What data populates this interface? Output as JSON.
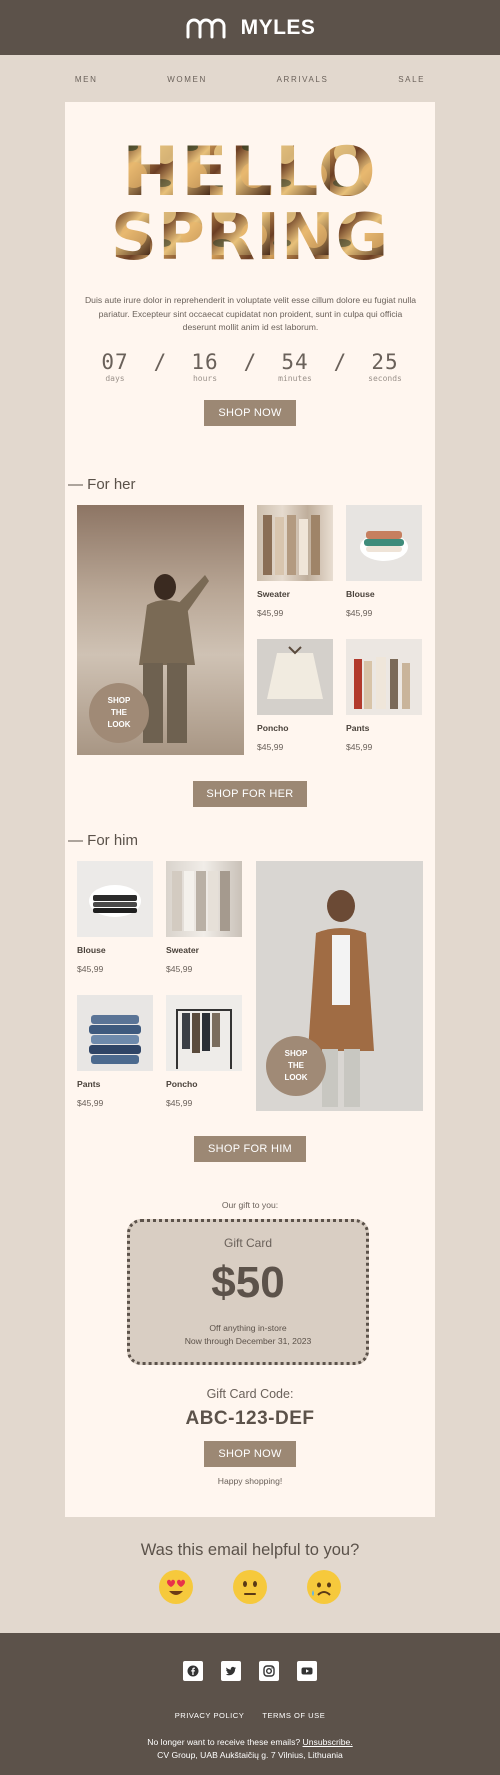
{
  "brand": {
    "name": "MYLES"
  },
  "nav": {
    "items": [
      "MEN",
      "WOMEN",
      "ARRIVALS",
      "SALE"
    ]
  },
  "hero": {
    "headline_line1": "HELLO",
    "headline_line2": "SPRING",
    "body": "Duis aute irure dolor in reprehenderit in voluptate velit esse cillum dolore eu fugiat nulla pariatur. Excepteur sint occaecat cupidatat non proident, sunt in culpa qui officia deserunt mollit anim id est laborum.",
    "countdown": [
      {
        "value": "07",
        "label": "days"
      },
      {
        "value": "16",
        "label": "hours"
      },
      {
        "value": "54",
        "label": "minutes"
      },
      {
        "value": "25",
        "label": "seconds"
      }
    ],
    "separator": "/",
    "button": "SHOP NOW"
  },
  "her": {
    "title": "— For her",
    "badge": [
      "SHOP",
      "THE",
      "LOOK"
    ],
    "products": [
      {
        "name": "Sweater",
        "price": "$45,99"
      },
      {
        "name": "Blouse",
        "price": "$45,99"
      },
      {
        "name": "Poncho",
        "price": "$45,99"
      },
      {
        "name": "Pants",
        "price": "$45,99"
      }
    ],
    "button": "SHOP FOR HER"
  },
  "him": {
    "title": "— For him",
    "badge": [
      "SHOP",
      "THE",
      "LOOK"
    ],
    "products": [
      {
        "name": "Blouse",
        "price": "$45,99"
      },
      {
        "name": "Sweater",
        "price": "$45,99"
      },
      {
        "name": "Pants",
        "price": "$45,99"
      },
      {
        "name": "Poncho",
        "price": "$45,99"
      }
    ],
    "button": "SHOP FOR HIM"
  },
  "gift": {
    "intro": "Our gift to you:",
    "title": "Gift Card",
    "amount": "$50",
    "line1": "Off anything in-store",
    "line2": "Now through December 31, 2023",
    "code_label": "Gift Card Code:",
    "code": "ABC-123-DEF",
    "button": "SHOP NOW",
    "closing": "Happy shopping!"
  },
  "feedback": {
    "question": "Was this email helpful to you?",
    "emojis": [
      "heart-eyes-emoji",
      "neutral-face-emoji",
      "sad-face-emoji"
    ]
  },
  "footer": {
    "social": [
      "facebook-icon",
      "twitter-icon",
      "instagram-icon",
      "youtube-icon"
    ],
    "links": [
      "PRIVACY POLICY",
      "TERMS OF USE"
    ],
    "unsub_text": "No longer want to receive these emails? ",
    "unsub_link": "Unsubscribe.",
    "address": "CV Group, UAB Aukštaičių g. 7 Vilnius, Lithuania"
  },
  "colors": {
    "header_bg": "#5c524a",
    "page_bg": "#e2d8ce",
    "card_bg": "#fff6ef",
    "button_bg": "#9c8874",
    "gift_bg": "#d9cec3"
  }
}
